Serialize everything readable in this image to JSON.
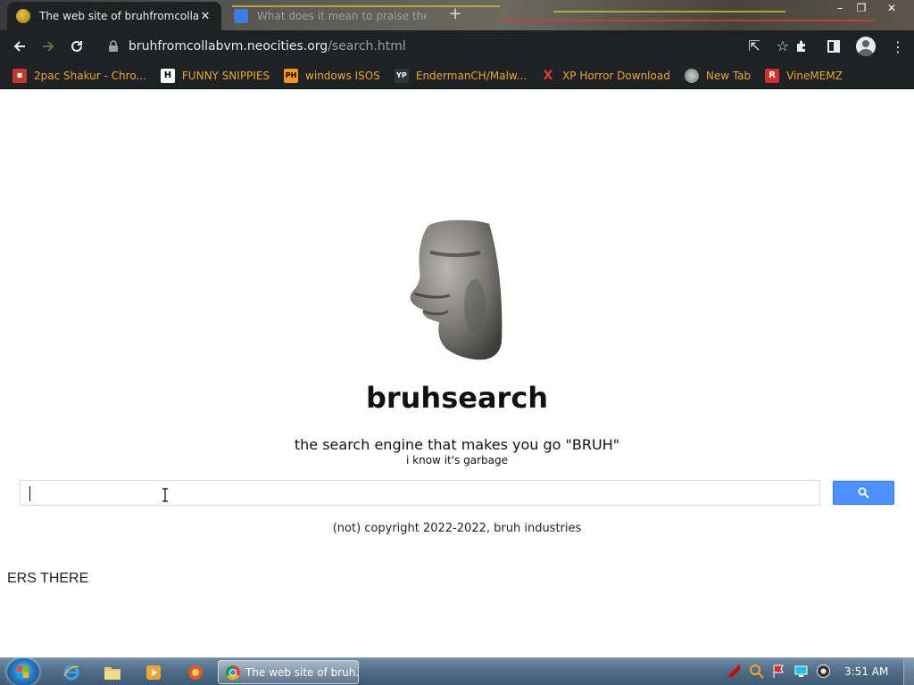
{
  "browser": {
    "tabs": [
      {
        "title": "The web site of bruhfromcollabvm",
        "active": true
      },
      {
        "title": "What does it mean to praise the",
        "active": false
      }
    ],
    "url_host": "bruhfromcollabvm.neocities.org",
    "url_path": "/search.html",
    "bookmarks": [
      {
        "label": "2pac Shakur - Chro...",
        "icon": "2pac-icon",
        "icon_text": "",
        "color": "#e04040"
      },
      {
        "label": "FUNNY SNIPPIES",
        "icon": "h-icon",
        "icon_text": "H",
        "color": "#ffffff"
      },
      {
        "label": "windows ISOS",
        "icon": "ph-icon",
        "icon_text": "PH",
        "color": "#f7971d"
      },
      {
        "label": "EndermanCH/Malw...",
        "icon": "yp-icon",
        "icon_text": "YP",
        "color": "#333333"
      },
      {
        "label": "XP Horror Download",
        "icon": "x-icon",
        "icon_text": "X",
        "color": "#e53935"
      },
      {
        "label": "New Tab",
        "icon": "globe-icon",
        "icon_text": "",
        "color": "#888888"
      },
      {
        "label": "VineMEMZ",
        "icon": "r-icon",
        "icon_text": "R",
        "color": "#d32f2f"
      }
    ]
  },
  "page": {
    "title": "bruhsearch",
    "tagline": "the search engine that makes you go \"BRUH\"",
    "subtagline": "i know it's garbage",
    "search_value": "",
    "copyright": "(not) copyright 2022-2022, bruh industries",
    "marquee": "ERS THERE",
    "logo": "moai-head-image"
  },
  "taskbar": {
    "task_label": "The web site of bruh...",
    "clock": "3:51 AM"
  },
  "colors": {
    "search_button": "#4d90fe",
    "bookmark_text": "#e8a634",
    "toolbar_bg": "#202124"
  }
}
